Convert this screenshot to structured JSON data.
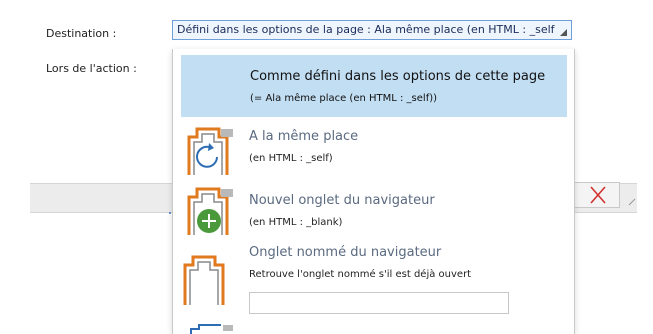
{
  "form": {
    "destination_label": "Destination :",
    "action_label": "Lors de l'action :",
    "destination_value": "Défini dans les options de la page : Ala même place (en HTML : _self"
  },
  "dropdown": {
    "options": [
      {
        "title": "Comme défini dans les options de cette page",
        "subtitle": "(= Ala même place (en HTML : _self))",
        "selected": true
      },
      {
        "title": "A la même place",
        "subtitle": "(en HTML : _self)",
        "icon": "same-place-icon"
      },
      {
        "title": "Nouvel onglet du navigateur",
        "subtitle": "(en HTML : _blank)",
        "icon": "new-tab-icon"
      },
      {
        "title": "Onglet nommé du navigateur",
        "subtitle": "Retrouve l'onglet nommé s'il est déjà ouvert",
        "icon": "named-tab-icon",
        "input_value": ""
      }
    ]
  },
  "colors": {
    "accent": "#c2def3",
    "icon_orange": "#e07a1f",
    "icon_blue": "#2e6db4",
    "add_green": "#4a9a3c",
    "close_red": "#d0312d"
  }
}
